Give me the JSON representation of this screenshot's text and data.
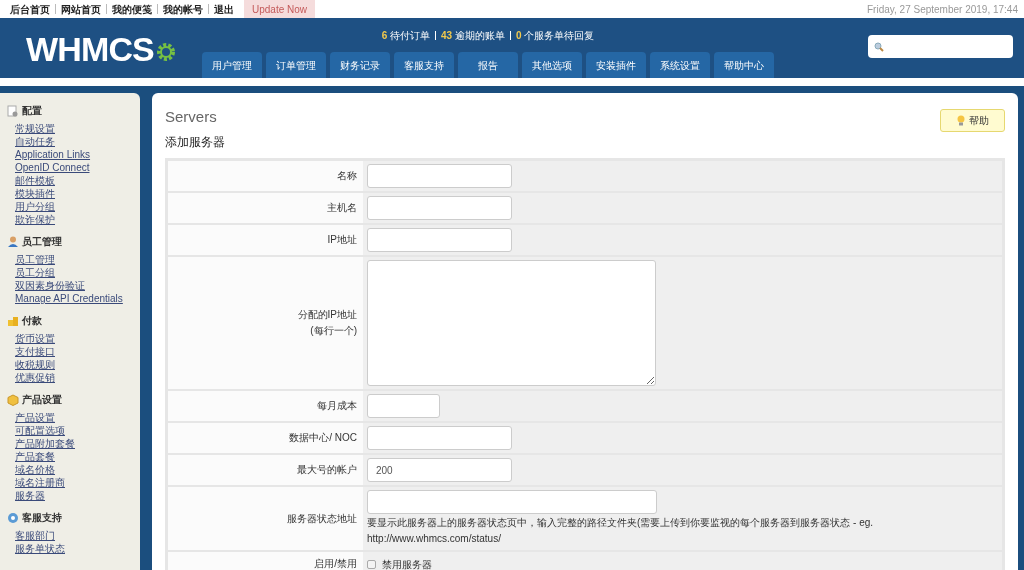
{
  "top_links": [
    "后台首页",
    "网站首页",
    "我的便笺",
    "我的帐号",
    "退出"
  ],
  "update_button": "Update Now",
  "datetime": "Friday, 27 September 2019, 17:44",
  "logo": "WHMCS",
  "stats": [
    {
      "count": "6",
      "label": "待付订单"
    },
    {
      "count": "43",
      "label": "逾期的账单"
    },
    {
      "count": "0",
      "label": "个服务单待回复"
    }
  ],
  "nav_tabs": [
    "用户管理",
    "订单管理",
    "财务记录",
    "客服支持",
    "报告",
    "其他选项",
    "安装插件",
    "系统设置",
    "帮助中心"
  ],
  "sidebar": [
    {
      "title": "配置",
      "kind": "gear",
      "items": [
        "常规设置",
        "自动任务",
        "Application Links",
        "OpenID Connect",
        "邮件模板",
        "模块插件",
        "用户分组",
        "欺诈保护"
      ]
    },
    {
      "title": "员工管理",
      "kind": "person",
      "items": [
        "员工管理",
        "员工分组",
        "双因素身份验证",
        "Manage API Credentials"
      ]
    },
    {
      "title": "付款",
      "kind": "coins",
      "items": [
        "货币设置",
        "支付接口",
        "收税规则",
        "优惠促销"
      ]
    },
    {
      "title": "产品设置",
      "kind": "box",
      "items": [
        "产品设置",
        "可配置选项",
        "产品附加套餐",
        "产品套餐",
        "域名价格",
        "域名注册商",
        "服务器"
      ]
    },
    {
      "title": "客服支持",
      "kind": "help",
      "items": [
        "客服部门",
        "服务单状态"
      ]
    }
  ],
  "page_title": "Servers",
  "help_button": "帮助",
  "section_title": "添加服务器",
  "form_rows": [
    {
      "label": "名称",
      "kind": "text"
    },
    {
      "label": "主机名",
      "kind": "text"
    },
    {
      "label": "IP地址",
      "kind": "text"
    },
    {
      "label": "分配的IP地址\n(每行一个)",
      "kind": "textarea"
    },
    {
      "label": "每月成本",
      "kind": "short_text"
    },
    {
      "label": "数据中心/ NOC",
      "kind": "text"
    },
    {
      "label": "最大号的帐户",
      "kind": "text",
      "value": "200"
    },
    {
      "label": "服务器状态地址",
      "kind": "long_text",
      "help": "要显示此服务器上的服务器状态页中，输入完整的路径文件夹(需要上传到你要监视的每个服务器到服务器状态 - eg. http://www.whmcs.com/status/"
    },
    {
      "label": "启用/禁用",
      "kind": "checkbox",
      "checked": false,
      "text": "禁用服务器"
    }
  ]
}
